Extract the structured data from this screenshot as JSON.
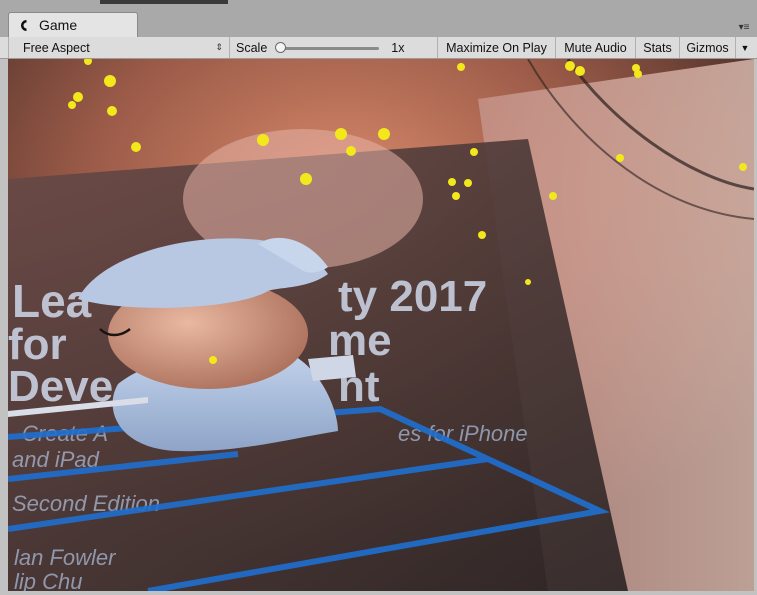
{
  "tab": {
    "title": "Game",
    "icon": "unity-logo-icon"
  },
  "toolbar": {
    "aspect": "Free Aspect",
    "scale_label": "Scale",
    "scale_value": "1x",
    "scale_slider_fraction": 0.0,
    "maximize_on_play": "Maximize On Play",
    "mute_audio": "Mute Audio",
    "stats": "Stats",
    "gizmos": "Gizmos"
  },
  "viewport": {
    "book_text": {
      "line1": "Lea",
      "line1b": "ty 2017",
      "line2": "for",
      "line2b": "me",
      "line3": "Deve",
      "line3b": "nt",
      "sub1": "Create A",
      "sub1b": "es for iPhone",
      "sub2": "and iPad",
      "edition": "Second Edition",
      "author1": "lan Fowler",
      "author2": "lip Chu"
    }
  }
}
